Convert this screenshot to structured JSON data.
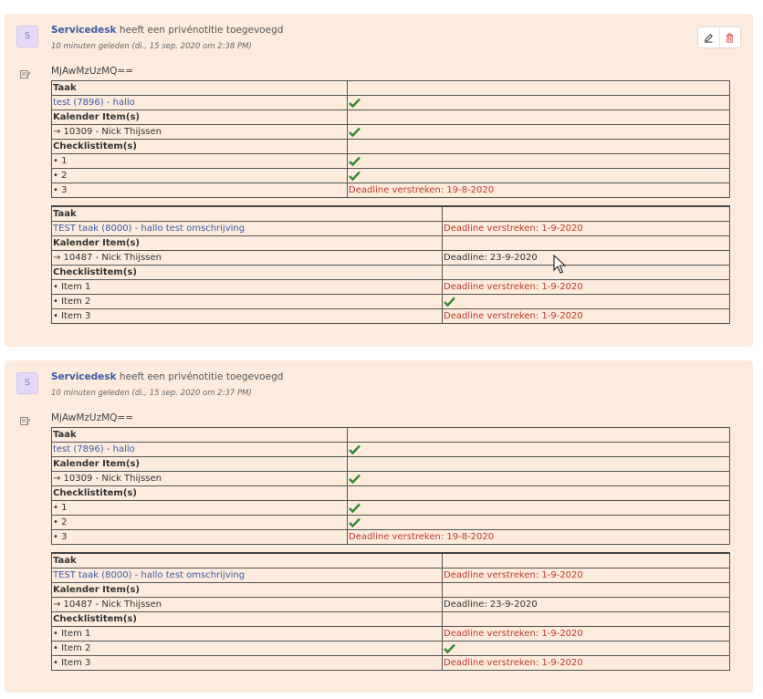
{
  "notes": [
    {
      "avatar": "S",
      "author": "Servicedesk",
      "action": "heeft een privénotitie toegevoegd",
      "timestamp": "10 minuten geleden (di., 15 sep. 2020 om 2:38 PM)",
      "code": "MjAwMzUzMQ==",
      "icons": {
        "edit": "pencil-icon",
        "delete": "trash-icon",
        "note": "note-icon",
        "check": "checkmark-icon"
      },
      "table1": {
        "taak_header": "Taak",
        "task_link": "test (7896) - hallo",
        "kalender_header": "Kalender Item(s)",
        "kalender_item": "→ 10309 - Nick Thijssen",
        "checklist_header": "Checklistitem(s)",
        "item1": "• 1",
        "item2": "• 2",
        "item3": "• 3",
        "item3_status": "Deadline verstreken: 19-8-2020"
      },
      "table2": {
        "taak_header": "Taak",
        "task_link": "TEST taak (8000) - hallo test omschrijving",
        "task_status": "Deadline verstreken: 1-9-2020",
        "kalender_header": "Kalender Item(s)",
        "kalender_item": "→ 10487 - Nick Thijssen",
        "kalender_status": "Deadline: 23-9-2020",
        "checklist_header": "Checklistitem(s)",
        "item1": "• Item 1",
        "item1_status": "Deadline verstreken: 1-9-2020",
        "item2": "• Item 2",
        "item3": "• Item 3",
        "item3_status": "Deadline verstreken: 1-9-2020"
      }
    },
    {
      "avatar": "S",
      "author": "Servicedesk",
      "action": "heeft een privénotitie toegevoegd",
      "timestamp": "10 minuten geleden (di., 15 sep. 2020 om 2:37 PM)",
      "code": "MjAwMzUzMQ==",
      "table1": {
        "taak_header": "Taak",
        "task_link": "test (7896) - hallo",
        "kalender_header": "Kalender Item(s)",
        "kalender_item": "→ 10309 - Nick Thijssen",
        "checklist_header": "Checklistitem(s)",
        "item1": "• 1",
        "item2": "• 2",
        "item3": "• 3",
        "item3_status": "Deadline verstreken: 19-8-2020"
      },
      "table2": {
        "taak_header": "Taak",
        "task_link": "TEST taak (8000) - hallo test omschrijving",
        "task_status": "Deadline verstreken: 1-9-2020",
        "kalender_header": "Kalender Item(s)",
        "kalender_item": "→ 10487 - Nick Thijssen",
        "kalender_status": "Deadline: 23-9-2020",
        "checklist_header": "Checklistitem(s)",
        "item1": "• Item 1",
        "item1_status": "Deadline verstreken: 1-9-2020",
        "item2": "• Item 2",
        "item3": "• Item 3",
        "item3_status": "Deadline verstreken: 1-9-2020"
      }
    }
  ],
  "colors": {
    "note_bg": "#fdebdd",
    "link": "#3a5aa8",
    "deadline_red": "#c0392b",
    "check_green": "#2e8b2e"
  }
}
